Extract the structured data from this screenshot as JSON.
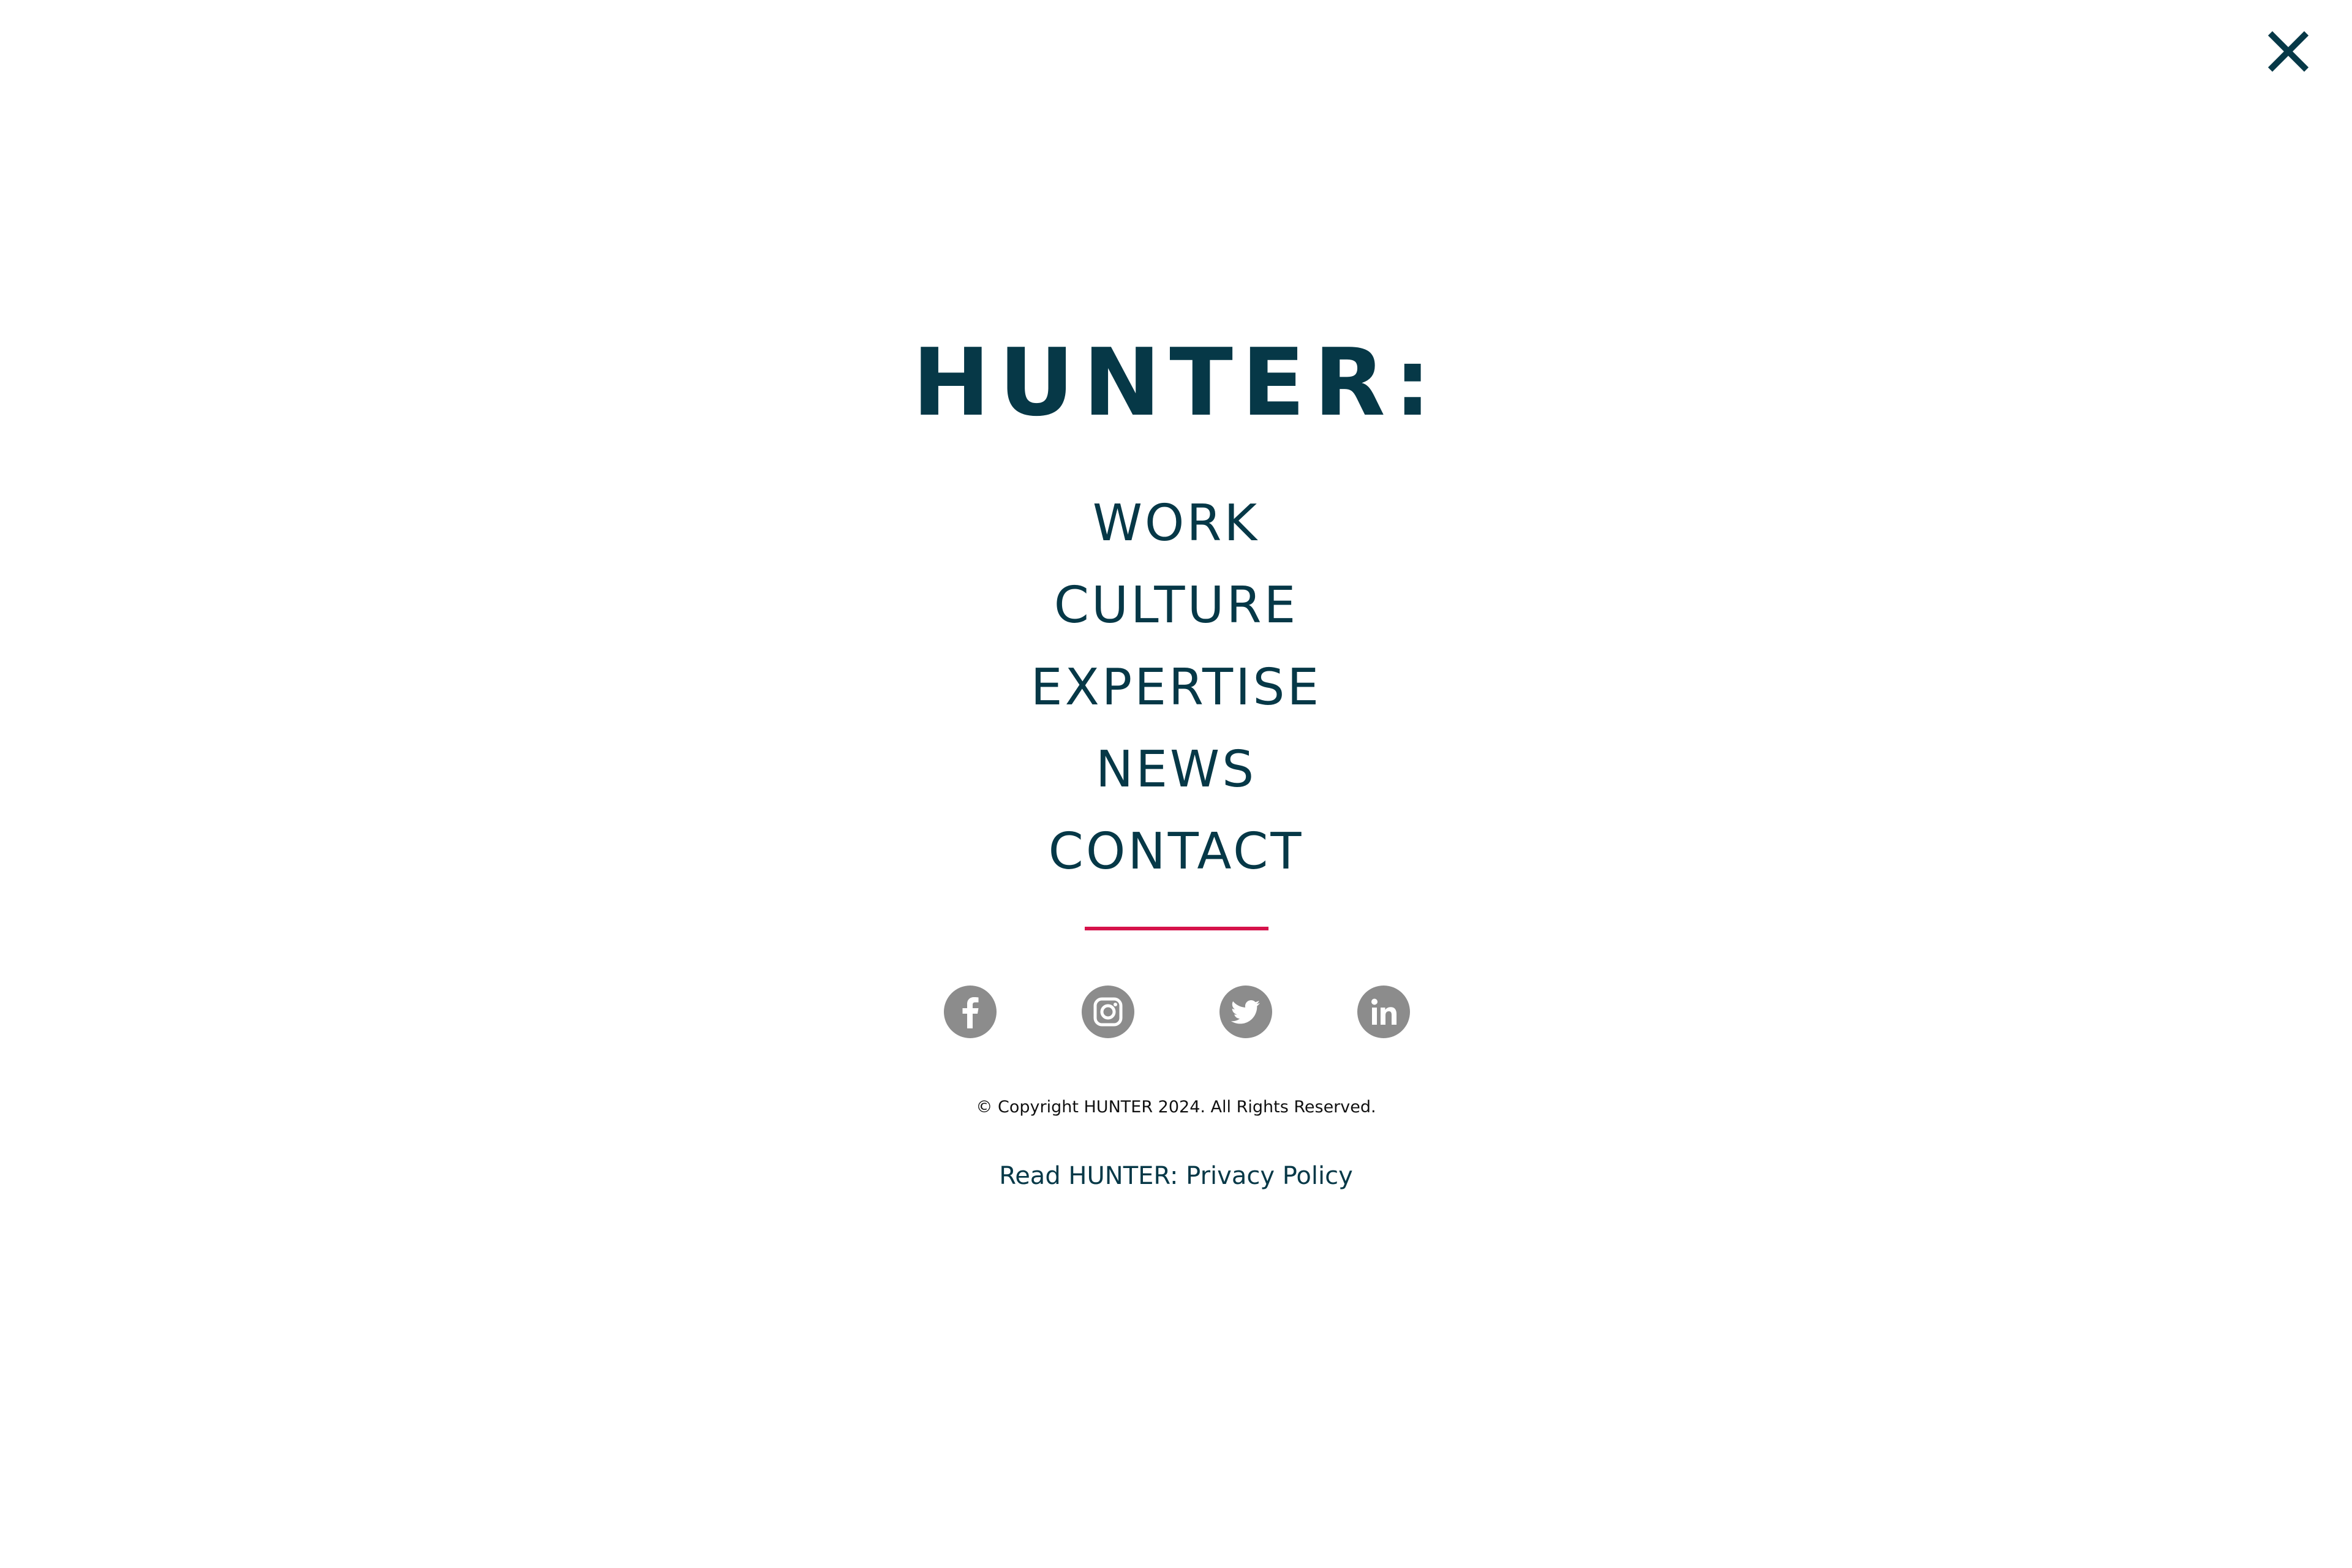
{
  "close": {
    "icon": "close-icon"
  },
  "logo": {
    "text": "HUNTER:"
  },
  "nav": {
    "items": [
      {
        "label": "WORK"
      },
      {
        "label": "CULTURE"
      },
      {
        "label": "EXPERTISE"
      },
      {
        "label": "NEWS"
      },
      {
        "label": "CONTACT"
      }
    ]
  },
  "social": {
    "items": [
      {
        "icon": "facebook-icon"
      },
      {
        "icon": "instagram-icon"
      },
      {
        "icon": "twitter-icon"
      },
      {
        "icon": "linkedin-icon"
      }
    ]
  },
  "footer": {
    "copyright": "© Copyright HUNTER 2024. All Rights Reserved.",
    "privacy_prefix": "Read HUNTER: ",
    "privacy_link": "Privacy Policy"
  },
  "colors": {
    "brand": "#063847",
    "accent": "#d6134b",
    "icon_bg": "#8c8c8c",
    "background": "#ffffff"
  }
}
